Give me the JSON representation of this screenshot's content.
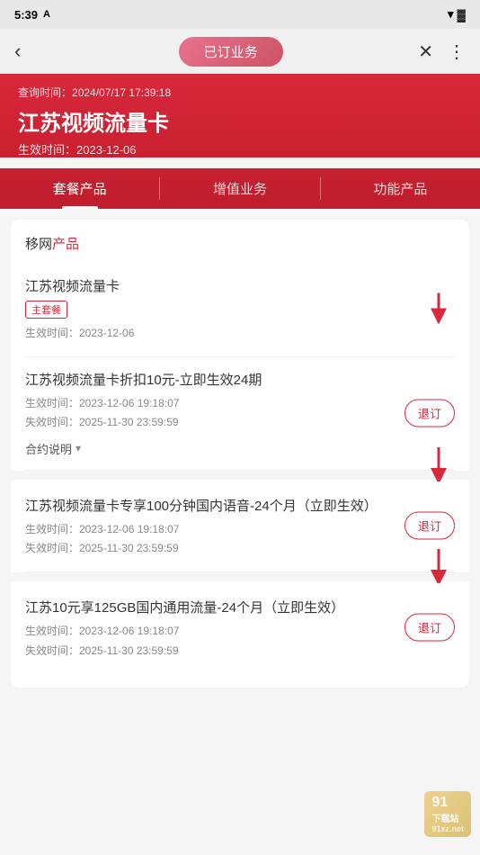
{
  "statusBar": {
    "time": "5:39",
    "wifiIcon": "▲",
    "batteryIcon": "🔋"
  },
  "header": {
    "backLabel": "‹",
    "titleLabel": "已订业务",
    "closeLabel": "✕",
    "moreLabel": "⋮"
  },
  "topSection": {
    "queryTimeLabel": "查询时间：",
    "queryTime": "2024/07/17 17:39:18",
    "pageTitle": "江苏视频流量卡",
    "effectiveTimeLabel": "生效时间：",
    "effectiveTime": "2023-12-06"
  },
  "tabs": [
    {
      "label": "套餐产品",
      "active": true
    },
    {
      "label": "增值业务",
      "active": false
    },
    {
      "label": "功能产品",
      "active": false
    }
  ],
  "content": {
    "sectionTitle": "移网",
    "sectionTitleAccent": "产品",
    "products": [
      {
        "id": 1,
        "name": "江苏视频流量卡",
        "badge": "主套餐",
        "hasBadge": true,
        "effectiveTime": "生效时间：2023-12-06",
        "hasUnsubscribe": false,
        "hasContract": false,
        "hasArrow": true
      },
      {
        "id": 2,
        "name": "江苏视频流量卡折扣10元-立即生效24期",
        "hasBadge": false,
        "effectiveTime": "生效时间：2023-12-06 19:18:07",
        "expireTime": "失效时间：2025-11-30 23:59:59",
        "hasUnsubscribe": true,
        "unsubscribeLabel": "退订",
        "hasContract": true,
        "contractLabel": "合约说明",
        "hasArrow": true
      },
      {
        "id": 3,
        "name": "江苏视频流量卡专享100分钟国内语音-24个月（立即生效）",
        "hasBadge": false,
        "effectiveTime": "生效时间：2023-12-06 19:18:07",
        "expireTime": "失效时间：2025-11-30 23:59:59",
        "hasUnsubscribe": true,
        "unsubscribeLabel": "退订",
        "hasContract": false,
        "hasArrow": true
      },
      {
        "id": 4,
        "name": "江苏10元享125GB国内通用流量-24个月（立即生效）",
        "hasBadge": false,
        "effectiveTime": "生效时间：2023-12-06 19:18:07",
        "expireTime": "失效时间：2025-11-30 23:59:59",
        "hasUnsubscribe": true,
        "unsubscribeLabel": "退订",
        "hasContract": false,
        "hasArrow": false
      }
    ]
  },
  "watermark": {
    "line1": "91",
    "line2": "下载站",
    "url": "91xz.net"
  }
}
